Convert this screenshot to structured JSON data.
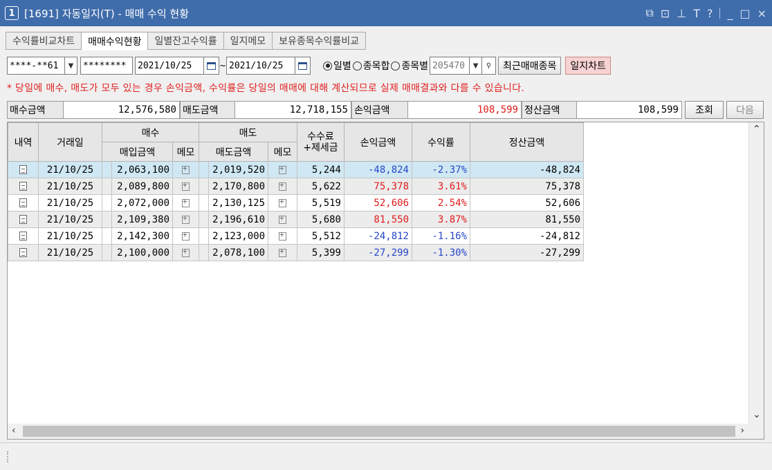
{
  "window": {
    "number": "1",
    "title": "[1691] 자동일지(T) - 매매 수익 현황"
  },
  "tabs": [
    "수익률비교차트",
    "매매수익현황",
    "일별잔고수익률",
    "일지메모",
    "보유종목수익률비교"
  ],
  "toolbar": {
    "account": "****-**61",
    "password": "********",
    "date_from": "2021/10/25",
    "tilde": "~",
    "date_to": "2021/10/25",
    "radio_daily": "일별",
    "radio_stock_sum": "종목합",
    "radio_by_stock": "종목별",
    "stock_code": "205470",
    "recent_stock_button": "최근매매종목",
    "journal_chart_button": "일지차트"
  },
  "notice": "* 당일에 매수, 매도가 모두 있는 경우 손익금액, 수익률은 당일의 매매에 대해 계산되므로 실제 매매결과와 다를 수 있습니다.",
  "summary": {
    "buy_label": "매수금액",
    "buy_value": "12,576,580",
    "sell_label": "매도금액",
    "sell_value": "12,718,155",
    "pl_label": "손익금액",
    "pl_value": "108,599",
    "settle_label": "정산금액",
    "settle_value": "108,599",
    "query_button": "조회",
    "next_button": "다음"
  },
  "table": {
    "headers": {
      "detail": "내역",
      "date": "거래일",
      "buy": "매수",
      "buy_amount": "매입금액",
      "buy_memo": "메모",
      "sell": "매도",
      "sell_amount": "매도금액",
      "sell_memo": "메모",
      "fee_line1": "수수료",
      "fee_line2": "+제세금",
      "pl": "손익금액",
      "rate": "수익률",
      "settle": "정산금액"
    },
    "rows": [
      {
        "date": "21/10/25",
        "buy": "2,063,100",
        "sell": "2,019,520",
        "fee": "5,244",
        "pl": "-48,824",
        "rate": "-2.37%",
        "settle": "-48,824",
        "sign": "neg"
      },
      {
        "date": "21/10/25",
        "buy": "2,089,800",
        "sell": "2,170,800",
        "fee": "5,622",
        "pl": "75,378",
        "rate": "3.61%",
        "settle": "75,378",
        "sign": "pos"
      },
      {
        "date": "21/10/25",
        "buy": "2,072,000",
        "sell": "2,130,125",
        "fee": "5,519",
        "pl": "52,606",
        "rate": "2.54%",
        "settle": "52,606",
        "sign": "pos"
      },
      {
        "date": "21/10/25",
        "buy": "2,109,380",
        "sell": "2,196,610",
        "fee": "5,680",
        "pl": "81,550",
        "rate": "3.87%",
        "settle": "81,550",
        "sign": "pos"
      },
      {
        "date": "21/10/25",
        "buy": "2,142,300",
        "sell": "2,123,000",
        "fee": "5,512",
        "pl": "-24,812",
        "rate": "-1.16%",
        "settle": "-24,812",
        "sign": "neg"
      },
      {
        "date": "21/10/25",
        "buy": "2,100,000",
        "sell": "2,078,100",
        "fee": "5,399",
        "pl": "-27,299",
        "rate": "-1.30%",
        "settle": "-27,299",
        "sign": "neg"
      }
    ]
  },
  "colors": {
    "titlebar": "#3f6cab",
    "negative": "#2646c7",
    "positive": "#e01b1b",
    "notice": "#e02020"
  }
}
